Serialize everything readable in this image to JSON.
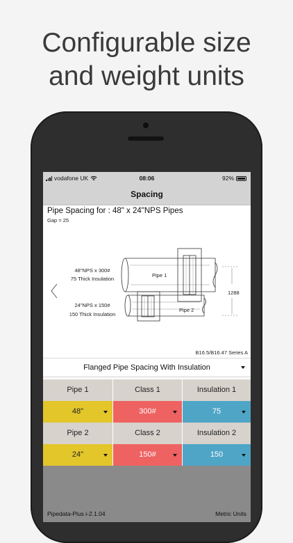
{
  "headline": {
    "line1": "Configurable size",
    "line2": "and weight units"
  },
  "status": {
    "carrier": "vodafone UK",
    "time": "08:06",
    "battery": "92%"
  },
  "nav": {
    "title": "Spacing"
  },
  "diagram": {
    "heading": "Pipe Spacing for : 48\" x 24\"NPS Pipes",
    "gap": "Gap = 25",
    "pipe1_spec": "48\"NPS  x  300#",
    "pipe1_insulation": "75 Thick Insulation",
    "pipe2_spec": "24\"NPS  x  150#",
    "pipe2_insulation": "150 Thick Insulation",
    "pipe1_label": "Pipe 1",
    "pipe2_label": "Pipe 2",
    "dimension": "1288",
    "series": "B16.5/B16.47 Series A"
  },
  "selector": {
    "value": "Flanged Pipe Spacing With Insulation"
  },
  "table": {
    "row1_headers": [
      "Pipe 1",
      "Class 1",
      "Insulation 1"
    ],
    "row1_values": [
      "48\"",
      "300#",
      "75"
    ],
    "row2_headers": [
      "Pipe 2",
      "Class 2",
      "Insulation 2"
    ],
    "row2_values": [
      "24\"",
      "150#",
      "150"
    ]
  },
  "footer": {
    "version": "Pipedata-Plus i-2.1.04",
    "units": "Metric Units"
  },
  "colors": {
    "pipe": "#e3c62a",
    "class": "#ee6262",
    "insulation": "#4fa5c6",
    "header": "#d7d2cc"
  }
}
